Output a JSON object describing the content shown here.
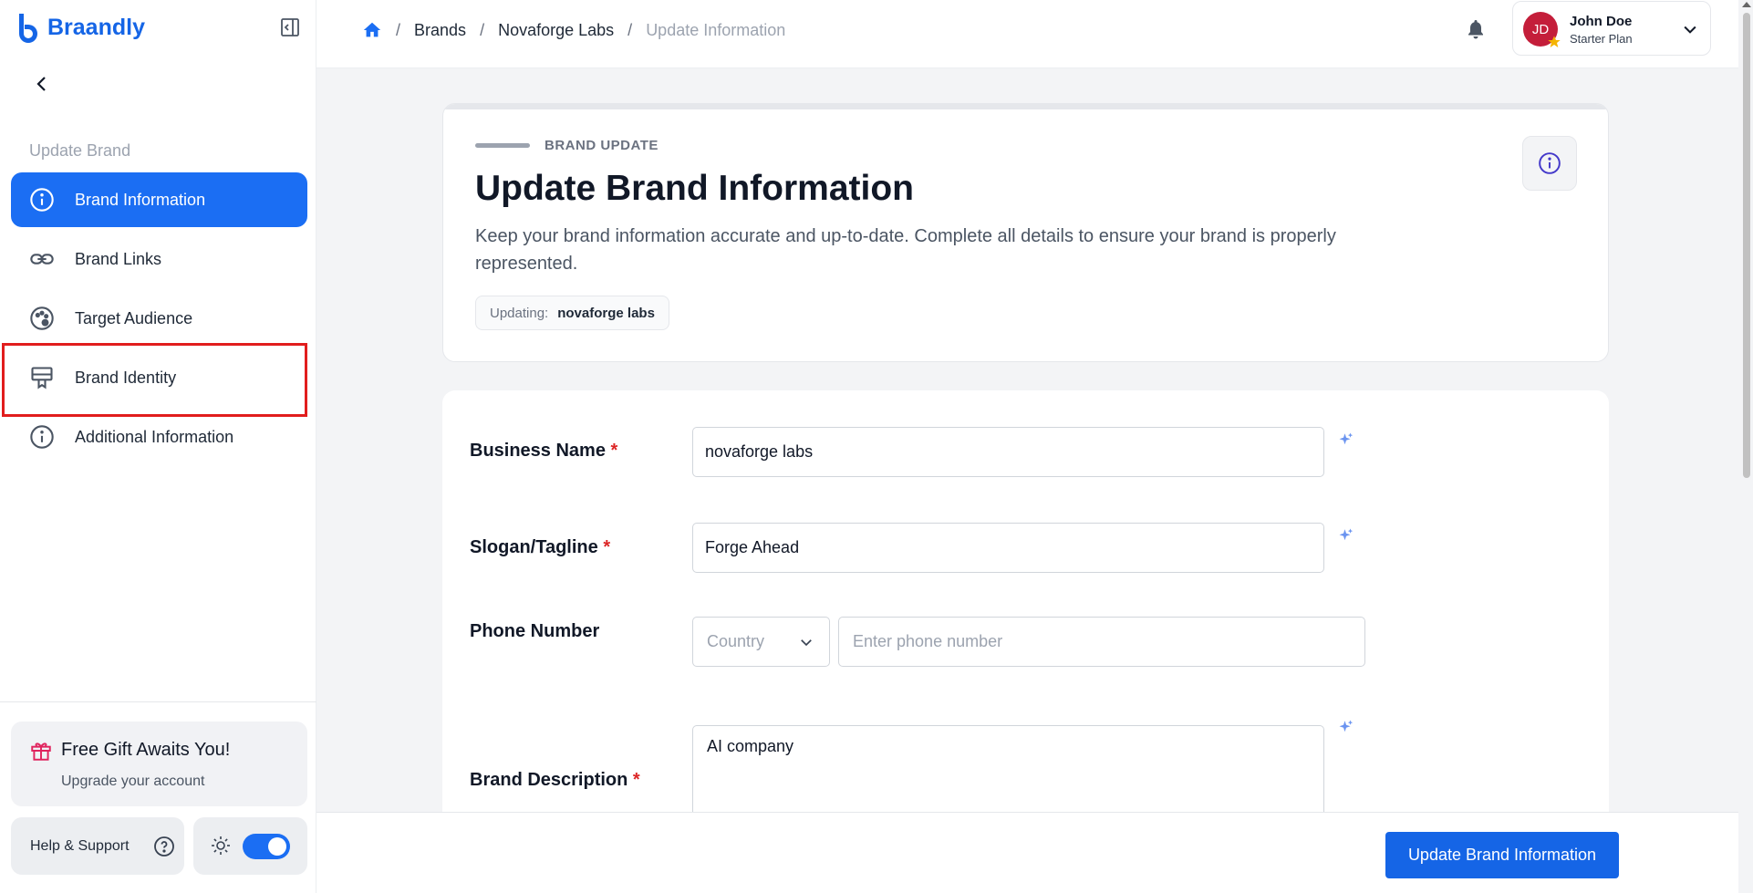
{
  "app": {
    "name": "Braandly",
    "brand_color": "#1565e6"
  },
  "sidebar": {
    "section_label": "Update Brand",
    "items": [
      {
        "label": "Brand Information",
        "icon": "info-circle-icon",
        "active": true
      },
      {
        "label": "Brand Links",
        "icon": "link-icon",
        "active": false
      },
      {
        "label": "Target Audience",
        "icon": "palette-icon",
        "active": false
      },
      {
        "label": "Brand Identity",
        "icon": "id-badge-icon",
        "active": false
      },
      {
        "label": "Additional Information",
        "icon": "info-circle-icon",
        "active": false
      }
    ],
    "gift": {
      "title": "Free Gift Awaits You!",
      "subtitle": "Upgrade your account"
    },
    "help_label": "Help & Support"
  },
  "header": {
    "breadcrumb": [
      "Brands",
      "Novaforge Labs",
      "Update Information"
    ],
    "user": {
      "initials": "JD",
      "name": "John Doe",
      "plan": "Starter Plan"
    }
  },
  "intro": {
    "eyebrow": "BRAND UPDATE",
    "title": "Update Brand Information",
    "description": "Keep your brand information accurate and up-to-date. Complete all details to ensure your brand is properly represented.",
    "chip_label": "Updating:",
    "chip_value": "novaforge labs"
  },
  "form": {
    "business_name": {
      "label": "Business Name",
      "required": "*",
      "value": "novaforge labs"
    },
    "slogan": {
      "label": "Slogan/Tagline",
      "required": "*",
      "value": "Forge Ahead"
    },
    "phone": {
      "label": "Phone Number",
      "country_placeholder": "Country",
      "placeholder": "Enter phone number"
    },
    "description": {
      "label": "Brand Description",
      "required": "*",
      "value": "AI company"
    }
  },
  "footer": {
    "submit_label": "Update Brand Information"
  }
}
